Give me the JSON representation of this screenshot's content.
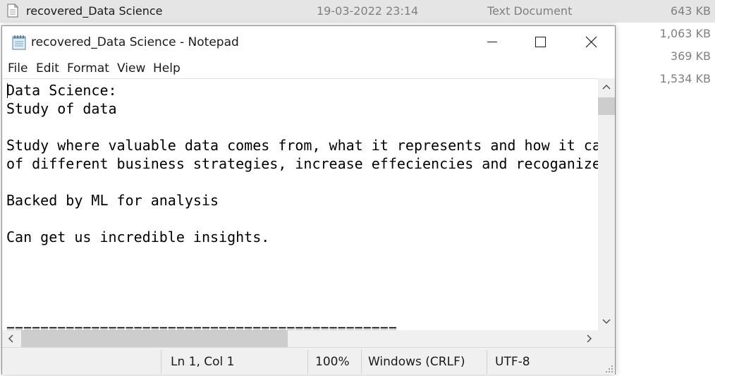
{
  "explorer": {
    "rows": [
      {
        "name": "recovered_Data Science",
        "date": "19-03-2022 23:14",
        "type": "Text Document",
        "size": "643 KB"
      },
      {
        "size": "1,063 KB"
      },
      {
        "size": "369 KB"
      },
      {
        "size": "1,534 KB"
      }
    ]
  },
  "notepad": {
    "title": "recovered_Data Science - Notepad",
    "menu": [
      "File",
      "Edit",
      "Format",
      "View",
      "Help"
    ],
    "content": "Data Science:\nStudy of data\n\nStudy where valuable data comes from, what it represents and how it ca\nof different business strategies, increase effeciencies and recoganize\n\nBacked by ML for analysis\n\nCan get us incredible insights.\n\n\n\n\n==============================================",
    "status": {
      "position": "Ln 1, Col 1",
      "zoom": "100%",
      "line_ending": "Windows (CRLF)",
      "encoding": "UTF-8"
    }
  }
}
